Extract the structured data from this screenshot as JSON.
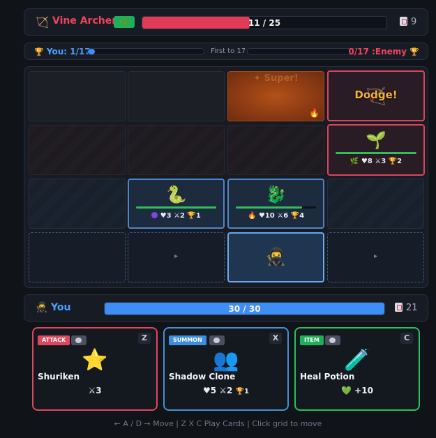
{
  "enemy": {
    "icon": "🏹",
    "name": "Vine Archer",
    "element_icon": "🌿",
    "hp_text": "11 / 25",
    "hp_fraction": 0.44,
    "hp_color": "#e23b55",
    "deck_count": "9"
  },
  "score": {
    "you_label": "You: 1/17",
    "you_fraction": 0.059,
    "goal": "First to 17",
    "enemy_label": "0/17 :Enemy",
    "enemy_fraction": 0,
    "trophy_icon": "🏆"
  },
  "board": {
    "fire_cell": {
      "faint_text": "✦ Super!",
      "corner_icon": "🔥"
    },
    "dodge_cell": {
      "icon": "🏹",
      "text": "Dodge!"
    },
    "enemy_unit": {
      "emoji": "🌱",
      "stats": "🌿 ♥8 ⚔3 🏆2",
      "hp_fraction": 1.0
    },
    "snake_unit": {
      "emoji": "🐍",
      "stats": "♥3 ⚔2 🏆1",
      "hp_fraction": 1.0
    },
    "dragon_unit": {
      "emoji": "🐉",
      "stats": "🔥 ♥10 ⚔6 🏆4",
      "hp_fraction": 0.83
    },
    "player_unit": {
      "emoji": "🥷"
    },
    "move_arrow": "▸"
  },
  "player": {
    "icon": "🥷",
    "name": "You",
    "hp_text": "30 / 30",
    "hp_fraction": 1.0,
    "hp_color": "#3e8ef7",
    "deck_count": "21"
  },
  "cards": [
    {
      "type": "ATTACK",
      "key": "Z",
      "emoji": "⭐",
      "name": "Shuriken",
      "stat": "⚔3"
    },
    {
      "type": "SUMMON",
      "key": "X",
      "emoji": "👥",
      "name": "Shadow Clone",
      "stat": "♥5 ⚔2",
      "stat_extra": "🏆1"
    },
    {
      "type": "ITEM",
      "key": "C",
      "emoji": "🧪",
      "name": "Heal Potion",
      "stat": "💚 +10"
    }
  ],
  "help": "← A / D → Move | Z X C Play Cards | Click grid to move"
}
